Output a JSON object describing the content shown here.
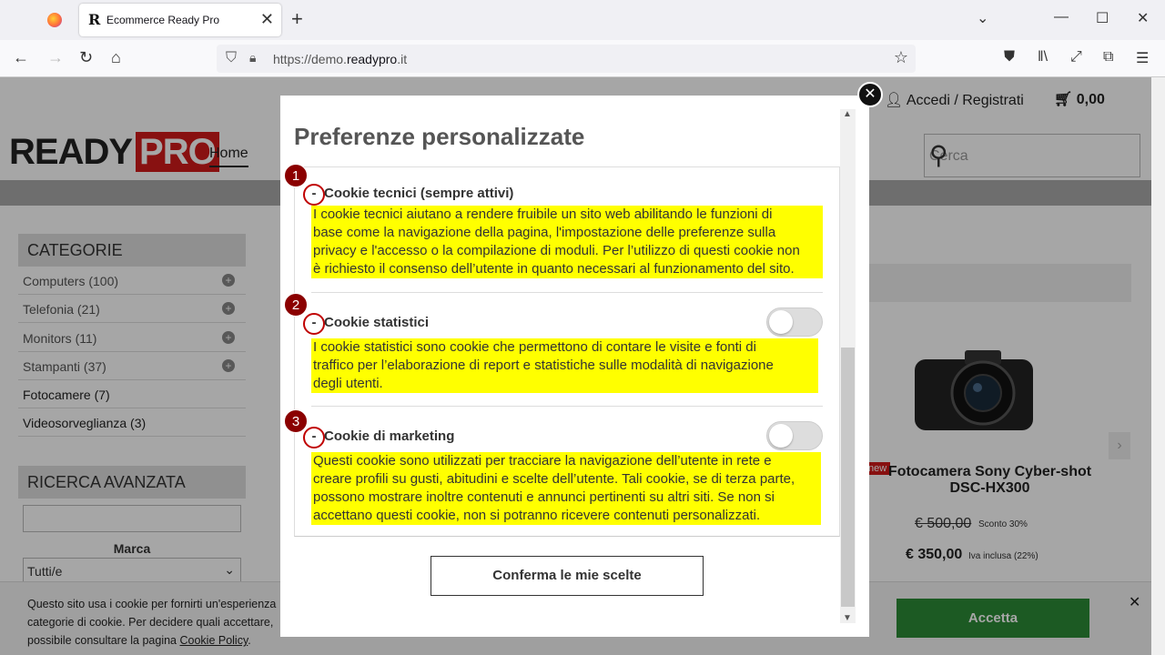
{
  "browser": {
    "tab_title": "Ecommerce Ready Pro",
    "tab_favicon": "R",
    "url_prefix": "https://demo.",
    "url_domain": "readypro",
    "url_suffix": ".it"
  },
  "site": {
    "logo_main": "READY",
    "logo_pro": "PRO",
    "nav_home": "Home",
    "login": "Accedi / Registrati",
    "cart_total": "0,00",
    "search_placeholder": "Cerca",
    "categories_title": "CATEGORIE",
    "categories": [
      {
        "label": "Computers (100)"
      },
      {
        "label": "Telefonia (21)"
      },
      {
        "label": "Monitors (11)"
      },
      {
        "label": "Stampanti (37)"
      },
      {
        "label": "Fotocamere (7)"
      },
      {
        "label": "Videosorveglianza (3)"
      }
    ],
    "advanced_title": "RICERCA AVANZATA",
    "marca_label": "Marca",
    "marca_value": "Tutti/e",
    "product": {
      "badge": "new",
      "title": "Fotocamera Sony Cyber-shot DSC-HX300",
      "old_price": "€ 500,00",
      "discount": "Sconto 30%",
      "price": "€ 350,00",
      "vat": "Iva inclusa (22%)"
    }
  },
  "cookie_bar": {
    "text": "Questo sito usa i cookie per fornirti un'esperienza categorie di cookie. Per decidere quali accettare, possibile consultare la pagina",
    "link": "Cookie Policy",
    "accept": "Accetta"
  },
  "modal": {
    "title": "Preferenze personalizzate",
    "sections": [
      {
        "num": "1",
        "title": "Cookie tecnici (sempre attivi)",
        "lines": [
          "I cookie tecnici aiutano a rendere fruibile un sito web abilitando le funzioni di",
          "base come la navigazione della pagina, l'impostazione delle preferenze sulla",
          "privacy e l'accesso o la compilazione di moduli. Per l’utilizzo di questi cookie non",
          "è richiesto il consenso dell’utente in quanto necessari al funzionamento del sito."
        ]
      },
      {
        "num": "2",
        "title": "Cookie statistici",
        "lines": [
          "I cookie statistici sono cookie che permettono di contare le visite e fonti di",
          "traffico per l’elaborazione di report e statistiche sulle modalità di navigazione",
          "degli utenti."
        ]
      },
      {
        "num": "3",
        "title": "Cookie di marketing",
        "lines": [
          "Questi cookie sono utilizzati per tracciare la navigazione dell’utente in rete e",
          "creare profili su gusti, abitudini e scelte dell’utente. Tali cookie, se di terza parte,",
          "possono mostrare inoltre contenuti e annunci pertinenti su altri siti. Se non si",
          "accettano questi cookie, non si potranno ricevere contenuti personalizzati."
        ]
      }
    ],
    "confirm": "Conferma le mie scelte"
  },
  "colors": {
    "highlight": "#ffff00",
    "annotation": "#8b0000",
    "accept_green": "#2c8a36",
    "brand_red": "#d11b1b"
  }
}
